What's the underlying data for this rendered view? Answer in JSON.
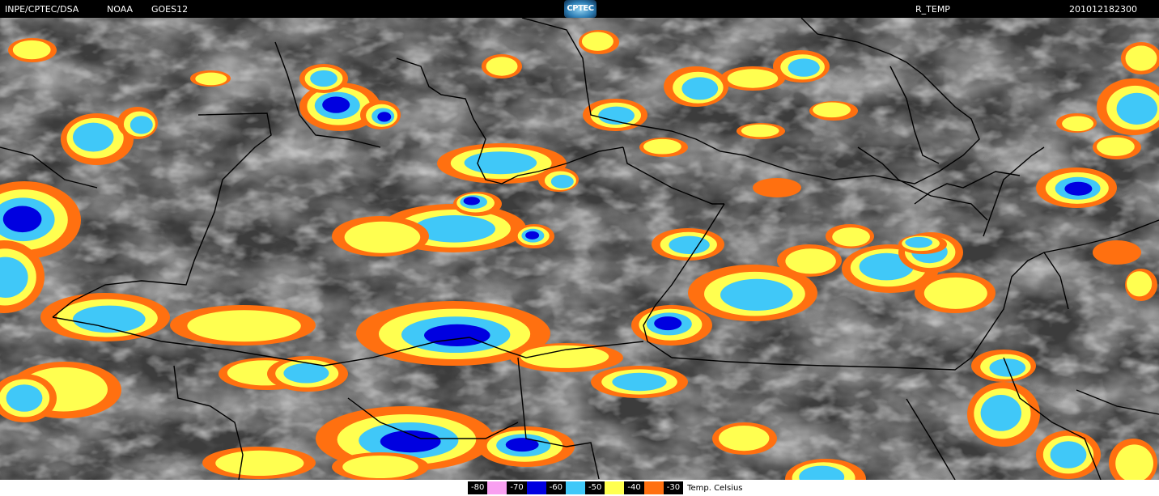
{
  "header": {
    "org": "INPE/CPTEC/DSA",
    "agency": "NOAA",
    "satellite": "GOES12",
    "logo_text": "CPTEC",
    "product": "R_TEMP",
    "datetime": "201012182300"
  },
  "legend": {
    "unit": "Temp. Celsius",
    "entries": [
      {
        "label": "-80",
        "color": "#f8a0f0"
      },
      {
        "label": "-70",
        "color": "#0000e0"
      },
      {
        "label": "-60",
        "color": "#40c8f8"
      },
      {
        "label": "-50",
        "color": "#ffff50"
      },
      {
        "label": "-40",
        "color": "#ff7010"
      },
      {
        "label": "-30",
        "color": "#000000"
      }
    ]
  },
  "colors": {
    "background_cloud": "#3c3c3c",
    "cold_orange": "#ff7010",
    "cold_yellow": "#ffff50",
    "cold_cyan": "#40c8f8",
    "cold_blue": "#0000e0",
    "cold_pink": "#f8a0f0",
    "borders": "#000000"
  }
}
